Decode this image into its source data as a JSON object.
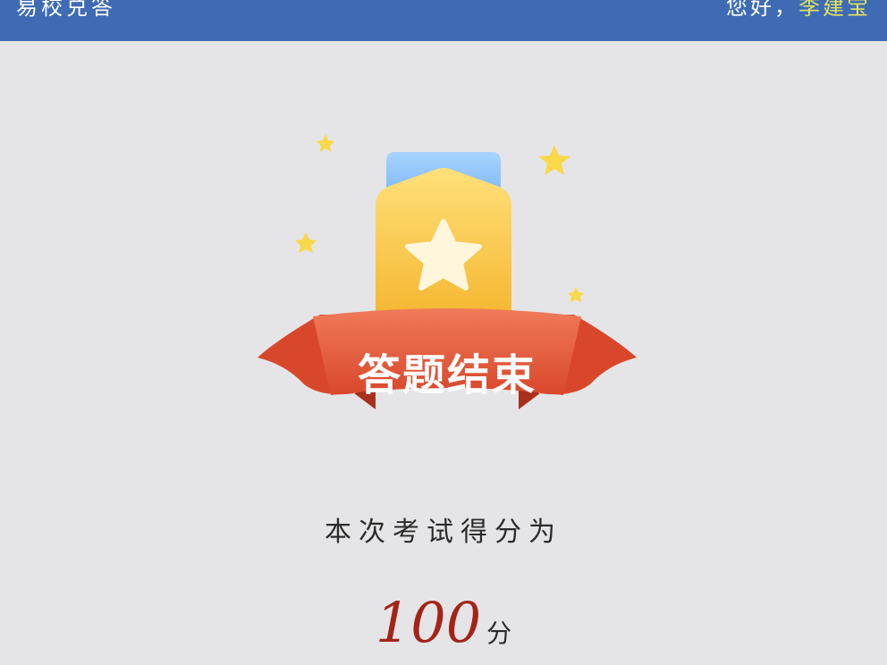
{
  "header": {
    "app_title": "易校兑答",
    "greeting_prefix": "您好，",
    "user_name": "李建宝"
  },
  "badge": {
    "label": "答题结束"
  },
  "result": {
    "caption": "本次考试得分为",
    "score": "100",
    "unit": "分"
  },
  "colors": {
    "header_bg": "#3f6bb5",
    "page_bg": "#e5e5e7",
    "ribbon": "#e45a3a",
    "medal": "#f7c23d",
    "score": "#a42418"
  },
  "icons": [
    "medal-icon",
    "star-icon",
    "ribbon-icon"
  ]
}
